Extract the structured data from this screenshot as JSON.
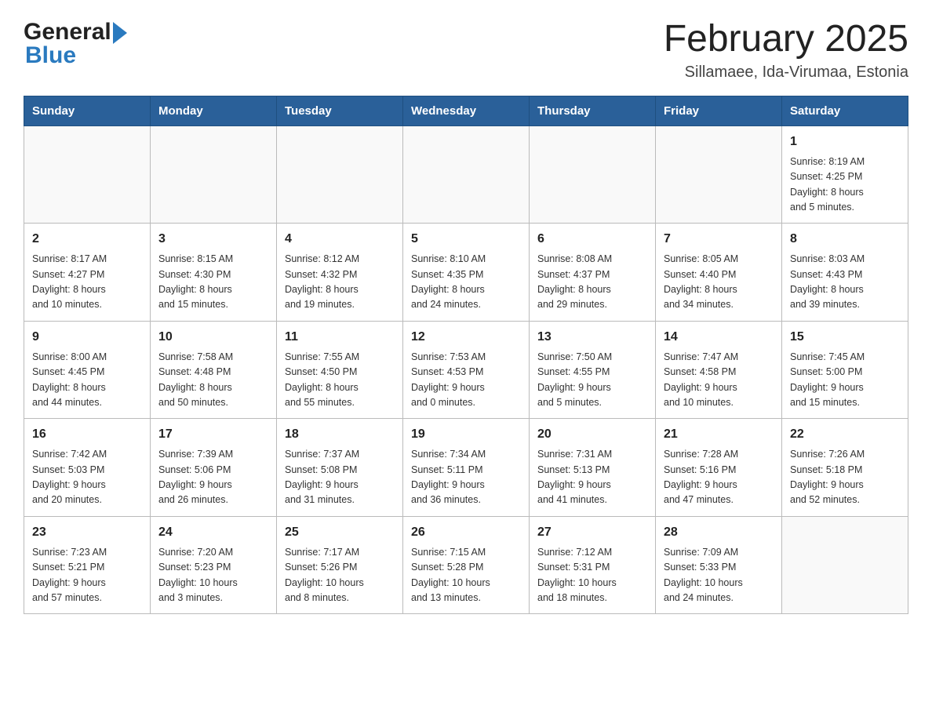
{
  "header": {
    "logo_general": "General",
    "logo_blue": "Blue",
    "title": "February 2025",
    "subtitle": "Sillamaee, Ida-Virumaa, Estonia"
  },
  "weekdays": [
    "Sunday",
    "Monday",
    "Tuesday",
    "Wednesday",
    "Thursday",
    "Friday",
    "Saturday"
  ],
  "weeks": [
    [
      {
        "day": "",
        "info": ""
      },
      {
        "day": "",
        "info": ""
      },
      {
        "day": "",
        "info": ""
      },
      {
        "day": "",
        "info": ""
      },
      {
        "day": "",
        "info": ""
      },
      {
        "day": "",
        "info": ""
      },
      {
        "day": "1",
        "info": "Sunrise: 8:19 AM\nSunset: 4:25 PM\nDaylight: 8 hours\nand 5 minutes."
      }
    ],
    [
      {
        "day": "2",
        "info": "Sunrise: 8:17 AM\nSunset: 4:27 PM\nDaylight: 8 hours\nand 10 minutes."
      },
      {
        "day": "3",
        "info": "Sunrise: 8:15 AM\nSunset: 4:30 PM\nDaylight: 8 hours\nand 15 minutes."
      },
      {
        "day": "4",
        "info": "Sunrise: 8:12 AM\nSunset: 4:32 PM\nDaylight: 8 hours\nand 19 minutes."
      },
      {
        "day": "5",
        "info": "Sunrise: 8:10 AM\nSunset: 4:35 PM\nDaylight: 8 hours\nand 24 minutes."
      },
      {
        "day": "6",
        "info": "Sunrise: 8:08 AM\nSunset: 4:37 PM\nDaylight: 8 hours\nand 29 minutes."
      },
      {
        "day": "7",
        "info": "Sunrise: 8:05 AM\nSunset: 4:40 PM\nDaylight: 8 hours\nand 34 minutes."
      },
      {
        "day": "8",
        "info": "Sunrise: 8:03 AM\nSunset: 4:43 PM\nDaylight: 8 hours\nand 39 minutes."
      }
    ],
    [
      {
        "day": "9",
        "info": "Sunrise: 8:00 AM\nSunset: 4:45 PM\nDaylight: 8 hours\nand 44 minutes."
      },
      {
        "day": "10",
        "info": "Sunrise: 7:58 AM\nSunset: 4:48 PM\nDaylight: 8 hours\nand 50 minutes."
      },
      {
        "day": "11",
        "info": "Sunrise: 7:55 AM\nSunset: 4:50 PM\nDaylight: 8 hours\nand 55 minutes."
      },
      {
        "day": "12",
        "info": "Sunrise: 7:53 AM\nSunset: 4:53 PM\nDaylight: 9 hours\nand 0 minutes."
      },
      {
        "day": "13",
        "info": "Sunrise: 7:50 AM\nSunset: 4:55 PM\nDaylight: 9 hours\nand 5 minutes."
      },
      {
        "day": "14",
        "info": "Sunrise: 7:47 AM\nSunset: 4:58 PM\nDaylight: 9 hours\nand 10 minutes."
      },
      {
        "day": "15",
        "info": "Sunrise: 7:45 AM\nSunset: 5:00 PM\nDaylight: 9 hours\nand 15 minutes."
      }
    ],
    [
      {
        "day": "16",
        "info": "Sunrise: 7:42 AM\nSunset: 5:03 PM\nDaylight: 9 hours\nand 20 minutes."
      },
      {
        "day": "17",
        "info": "Sunrise: 7:39 AM\nSunset: 5:06 PM\nDaylight: 9 hours\nand 26 minutes."
      },
      {
        "day": "18",
        "info": "Sunrise: 7:37 AM\nSunset: 5:08 PM\nDaylight: 9 hours\nand 31 minutes."
      },
      {
        "day": "19",
        "info": "Sunrise: 7:34 AM\nSunset: 5:11 PM\nDaylight: 9 hours\nand 36 minutes."
      },
      {
        "day": "20",
        "info": "Sunrise: 7:31 AM\nSunset: 5:13 PM\nDaylight: 9 hours\nand 41 minutes."
      },
      {
        "day": "21",
        "info": "Sunrise: 7:28 AM\nSunset: 5:16 PM\nDaylight: 9 hours\nand 47 minutes."
      },
      {
        "day": "22",
        "info": "Sunrise: 7:26 AM\nSunset: 5:18 PM\nDaylight: 9 hours\nand 52 minutes."
      }
    ],
    [
      {
        "day": "23",
        "info": "Sunrise: 7:23 AM\nSunset: 5:21 PM\nDaylight: 9 hours\nand 57 minutes."
      },
      {
        "day": "24",
        "info": "Sunrise: 7:20 AM\nSunset: 5:23 PM\nDaylight: 10 hours\nand 3 minutes."
      },
      {
        "day": "25",
        "info": "Sunrise: 7:17 AM\nSunset: 5:26 PM\nDaylight: 10 hours\nand 8 minutes."
      },
      {
        "day": "26",
        "info": "Sunrise: 7:15 AM\nSunset: 5:28 PM\nDaylight: 10 hours\nand 13 minutes."
      },
      {
        "day": "27",
        "info": "Sunrise: 7:12 AM\nSunset: 5:31 PM\nDaylight: 10 hours\nand 18 minutes."
      },
      {
        "day": "28",
        "info": "Sunrise: 7:09 AM\nSunset: 5:33 PM\nDaylight: 10 hours\nand 24 minutes."
      },
      {
        "day": "",
        "info": ""
      }
    ]
  ]
}
